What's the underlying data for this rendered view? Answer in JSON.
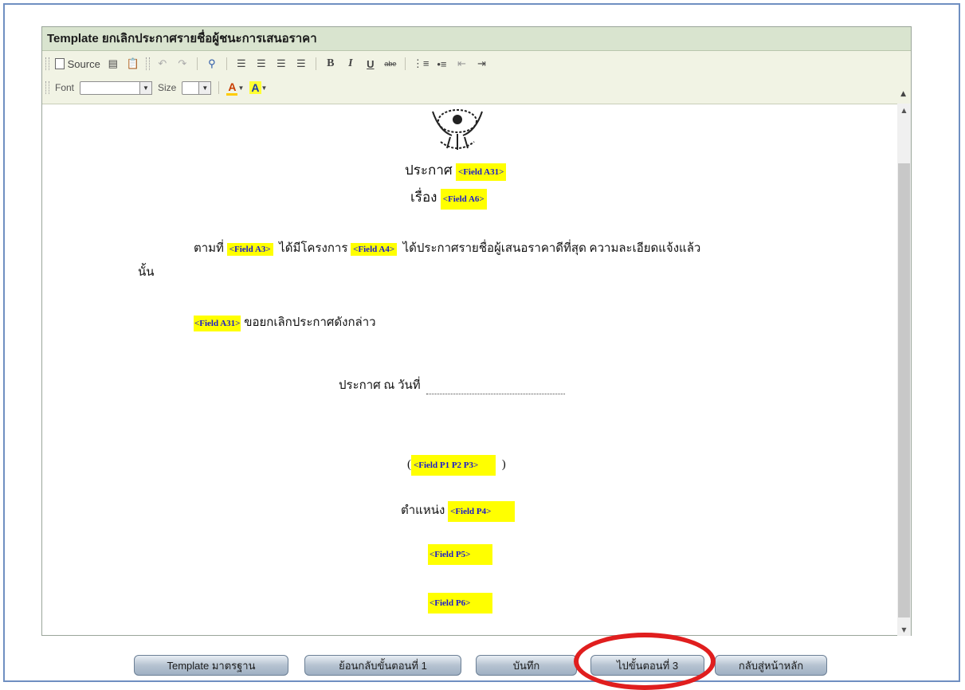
{
  "header": {
    "title": "Template ยกเลิกประกาศรายชื่อผู้ชนะการเสนอราคา"
  },
  "toolbar": {
    "source_label": "Source",
    "bold": "B",
    "italic": "I",
    "underline": "U",
    "strike": "abe",
    "font_label": "Font",
    "size_label": "Size",
    "text_color_glyph": "A",
    "bg_color_glyph": "A"
  },
  "document": {
    "announce_prefix": "ประกาศ",
    "announce_field": "<Field A31>",
    "subject_prefix": "เรื่อง",
    "subject_field": "<Field A6>",
    "para1_text1": "ตามที่",
    "para1_field1": "<Field A3>",
    "para1_text2": "ได้มีโครงการ",
    "para1_field2": "<Field A4>",
    "para1_text3": "ได้ประกาศรายชื่อผู้เสนอราคาดีที่สุด ความละเอียดแจ้งแล้ว",
    "para1_cont": "นั้น",
    "para2_field": "<Field A31>",
    "para2_text": "ขอยกเลิกประกาศดังกล่าว",
    "date_label": "ประกาศ ณ วันที่",
    "sign_open": "(",
    "sign_field": "<Field P1 P2 P3>",
    "sign_close": ")",
    "position_label": "ตำแหน่ง",
    "position_field": "<Field P4>",
    "field_p5": "<Field P5>",
    "field_p6": "<Field P6>"
  },
  "buttons": {
    "template_standard": "Template มาตรฐาน",
    "back_step1": "ย้อนกลับขั้นตอนที่ 1",
    "save": "บันทึก",
    "go_step3": "ไปขั้นตอนที่ 3",
    "home": "กลับสู่หน้าหลัก"
  },
  "colors": {
    "title_bar": "#d9e4cf",
    "field_highlight": "#ffff00",
    "field_text": "#1a1acc",
    "annotation_circle": "#e01e1e"
  }
}
